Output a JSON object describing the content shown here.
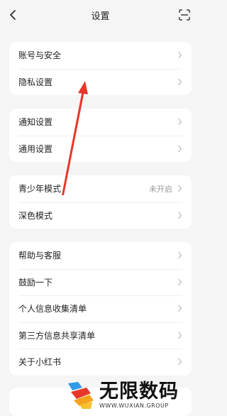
{
  "header": {
    "title": "设置",
    "back_icon": "chevron-left-icon",
    "scan_icon": "scan-icon"
  },
  "groups": [
    {
      "items": [
        {
          "label": "账号与安全"
        },
        {
          "label": "隐私设置"
        }
      ]
    },
    {
      "items": [
        {
          "label": "通知设置"
        },
        {
          "label": "通用设置"
        }
      ]
    },
    {
      "items": [
        {
          "label": "青少年模式",
          "value": "未开启"
        },
        {
          "label": "深色模式"
        }
      ]
    },
    {
      "items": [
        {
          "label": "帮助与客服"
        },
        {
          "label": "鼓励一下"
        },
        {
          "label": "个人信息收集清单"
        },
        {
          "label": "第三方信息共享清单"
        },
        {
          "label": "关于小红书"
        }
      ]
    }
  ],
  "annotation": {
    "color": "#e8362b"
  },
  "watermark": {
    "text": "无限数码",
    "subtext": "WWW.WUXIAN.GROUP"
  },
  "colors": {
    "background": "#f5f5f5",
    "card": "#ffffff",
    "text": "#222222",
    "secondary_text": "#9a9a9a",
    "chevron": "#bbbbbb",
    "divider": "#eeeeee"
  }
}
